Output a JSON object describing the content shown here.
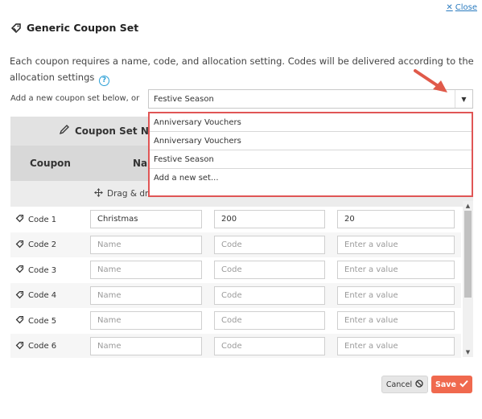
{
  "close_label": "Close",
  "title": "Generic Coupon Set",
  "description": "Each coupon requires a name, code, and allocation setting. Codes will be delivered according to the allocation settings",
  "add_label": "Add a new coupon set below, or",
  "select": {
    "value": "Festive Season"
  },
  "dropdown_options": [
    "Anniversary Vouchers",
    "Anniversary Vouchers",
    "Festive Season",
    "Add a new set..."
  ],
  "table": {
    "set_name_header": "Coupon Set Na",
    "col_coupon": "Coupon",
    "col_name": "Na",
    "drag_hint": "Drag & dr",
    "rows": [
      {
        "code": "Code 1",
        "name": "Christmas",
        "code_val": "200",
        "value": "20"
      },
      {
        "code": "Code 2",
        "name": "Name",
        "code_val": "Code",
        "value": "Enter a value"
      },
      {
        "code": "Code 3",
        "name": "Name",
        "code_val": "Code",
        "value": "Enter a value"
      },
      {
        "code": "Code 4",
        "name": "Name",
        "code_val": "Code",
        "value": "Enter a value"
      },
      {
        "code": "Code 5",
        "name": "Name",
        "code_val": "Code",
        "value": "Enter a value"
      },
      {
        "code": "Code 6",
        "name": "Name",
        "code_val": "Code",
        "value": "Enter a value"
      }
    ]
  },
  "buttons": {
    "cancel": "Cancel",
    "save": "Save"
  },
  "colors": {
    "accent": "#f0694e",
    "highlight_border": "#e05555",
    "link": "#2a7bbf",
    "help": "#2a9fd6"
  },
  "icons": {
    "close": "close-icon",
    "title": "tag-icon",
    "help": "question-circle-icon",
    "caret": "caret-down-icon",
    "drag": "move-icon",
    "code": "tag-icon",
    "cancel": "ban-icon",
    "save": "check-icon"
  }
}
